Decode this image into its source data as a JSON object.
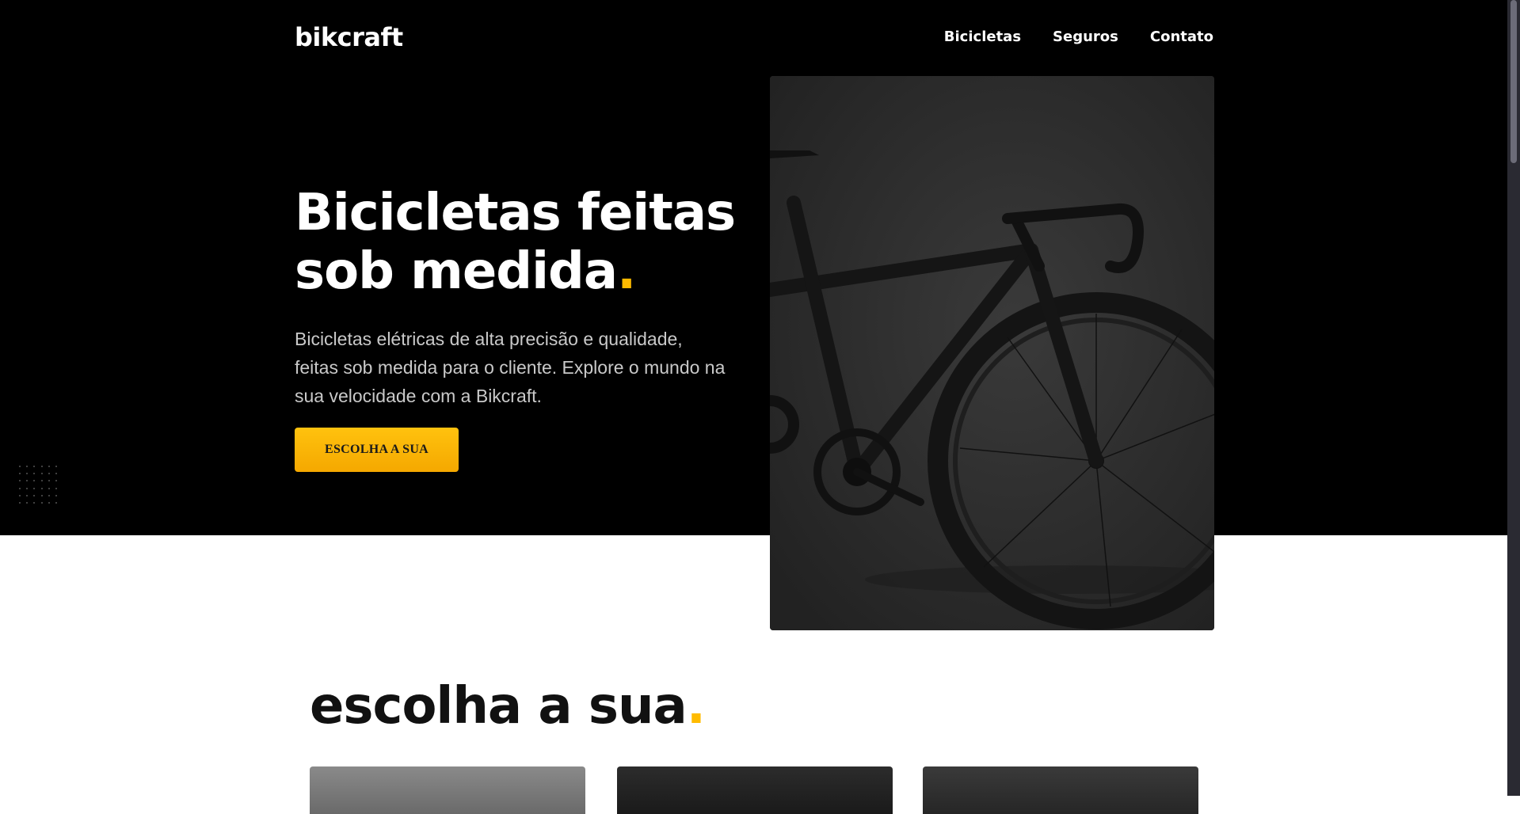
{
  "header": {
    "logo": "bikcraft",
    "nav": [
      "Bicicletas",
      "Seguros",
      "Contato"
    ]
  },
  "hero": {
    "title_line1": "Bicicletas feitas",
    "title_line2": "sob medida",
    "title_dot": ".",
    "description": "Bicicletas elétricas de alta precisão e qualidade, feitas sob medida para o cliente. Explore o mundo na sua velocidade com a Bikcraft.",
    "cta_label": "ESCOLHA A SUA"
  },
  "section": {
    "title": "escolha a sua",
    "title_dot": "."
  },
  "colors": {
    "accent": "#FFBB00",
    "hero_background": "#000000",
    "page_background": "#FFFFFF"
  },
  "icons": [
    "bicycle-image"
  ]
}
